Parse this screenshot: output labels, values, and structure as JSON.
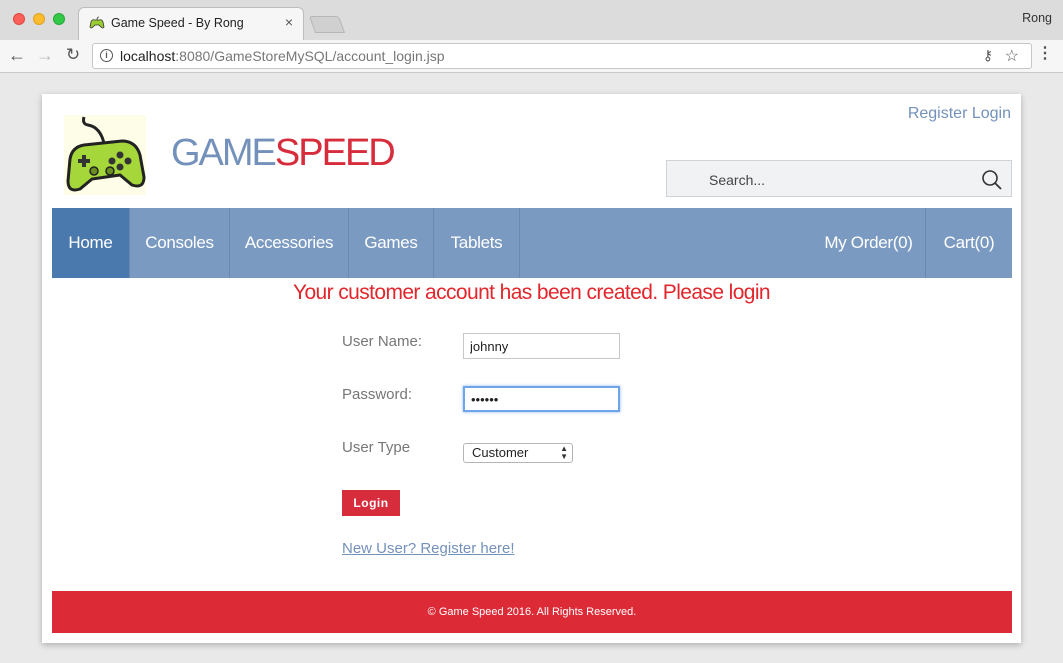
{
  "browser": {
    "tab_title": "Game Speed - By Rong",
    "tab_close": "×",
    "profile": "Rong",
    "url_host": "localhost",
    "url_path": ":8080/GameStoreMySQL/account_login.jsp"
  },
  "header": {
    "brand_part1": "GAME",
    "brand_part2": "SPEED",
    "register_link": "Register",
    "login_link": "Login",
    "search_placeholder": "Search..."
  },
  "nav": {
    "items": [
      {
        "label": "Home",
        "active": true
      },
      {
        "label": "Consoles"
      },
      {
        "label": "Accessories"
      },
      {
        "label": "Games"
      },
      {
        "label": "Tablets"
      }
    ],
    "right_items": [
      {
        "label": "My Order(0)"
      },
      {
        "label": "Cart(0)"
      }
    ]
  },
  "form": {
    "message": "Your customer account has been created. Please login",
    "username_label": "User Name:",
    "username_value": "johnny",
    "password_label": "Password:",
    "password_value": "••••••",
    "usertype_label": "User Type",
    "usertype_value": "Customer",
    "login_button": "Login",
    "register_link": "New User? Register here!"
  },
  "footer": {
    "text": "© Game Speed 2016. All Rights Reserved."
  },
  "colors": {
    "nav_bg": "#7b9ac1",
    "nav_active": "#4a79ad",
    "accent_red": "#d72c3b",
    "brand_blue": "#7391bb"
  }
}
